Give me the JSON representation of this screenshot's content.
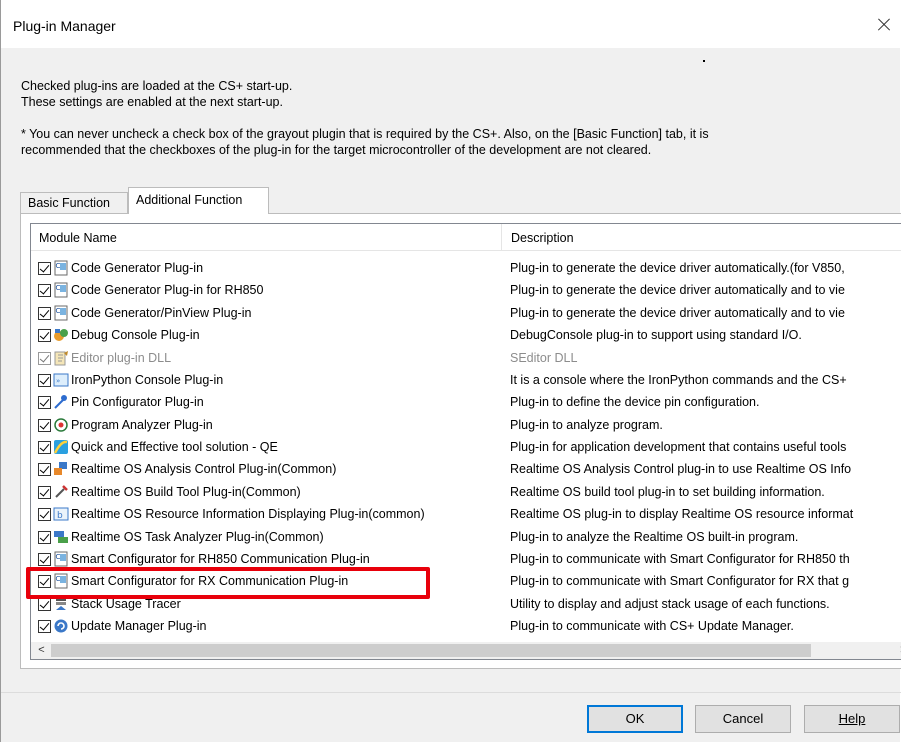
{
  "window": {
    "title": "Plug-in Manager"
  },
  "info": {
    "line1": "Checked plug-ins are loaded at the CS+ start-up.",
    "line2": "These settings are enabled at the next start-up.",
    "note1": "* You can never uncheck a check box of the grayout plugin that is required by the CS+. Also, on the [Basic Function] tab, it is",
    "note2": "recommended that the checkboxes of the plug-in for the target microcontroller of the development are not cleared."
  },
  "tabs": [
    "Basic Function",
    "Additional Function"
  ],
  "active_tab": "Additional Function",
  "columns": {
    "name": "Module Name",
    "description": "Description"
  },
  "rows": [
    {
      "name": "Code Generator Plug-in",
      "description": "Plug-in to generate the device driver automatically.(for V850,",
      "checked": true,
      "gray": false,
      "icon": "c-file-icon"
    },
    {
      "name": "Code Generator Plug-in for RH850",
      "description": "Plug-in to generate the device driver automatically and to vie",
      "checked": true,
      "gray": false,
      "icon": "c-file-icon"
    },
    {
      "name": "Code Generator/PinView Plug-in",
      "description": "Plug-in to generate the device driver automatically and to vie",
      "checked": true,
      "gray": false,
      "icon": "c-file-icon"
    },
    {
      "name": "Debug Console Plug-in",
      "description": "DebugConsole plug-in to support using standard I/O.",
      "checked": true,
      "gray": false,
      "icon": "debug-console-icon"
    },
    {
      "name": "Editor plug-in DLL",
      "description": "SEditor DLL",
      "checked": true,
      "gray": true,
      "icon": "editor-icon"
    },
    {
      "name": "IronPython Console Plug-in",
      "description": "It is a console where the IronPython commands and the CS+",
      "checked": true,
      "gray": false,
      "icon": "console-icon"
    },
    {
      "name": "Pin Configurator Plug-in",
      "description": "Plug-in to define the device pin configuration.",
      "checked": true,
      "gray": false,
      "icon": "pin-icon"
    },
    {
      "name": "Program Analyzer Plug-in",
      "description": "Plug-in to analyze program.",
      "checked": true,
      "gray": false,
      "icon": "analyzer-icon"
    },
    {
      "name": "Quick and Effective tool solution - QE",
      "description": "Plug-in for application development that contains useful tools",
      "checked": true,
      "gray": false,
      "icon": "qe-icon"
    },
    {
      "name": "Realtime OS Analysis Control Plug-in(Common)",
      "description": "Realtime OS Analysis Control plug-in to use Realtime OS Info",
      "checked": true,
      "gray": false,
      "icon": "rtos-analysis-icon"
    },
    {
      "name": "Realtime OS Build Tool Plug-in(Common)",
      "description": "Realtime OS build tool plug-in to set building information.",
      "checked": true,
      "gray": false,
      "icon": "build-tool-icon"
    },
    {
      "name": "Realtime OS Resource Information Displaying Plug-in(common)",
      "description": "Realtime OS plug-in to display Realtime OS resource informat",
      "checked": true,
      "gray": false,
      "icon": "resource-icon"
    },
    {
      "name": "Realtime OS Task Analyzer Plug-in(Common)",
      "description": "Plug-in to analyze the Realtime OS built-in program.",
      "checked": true,
      "gray": false,
      "icon": "task-analyzer-icon"
    },
    {
      "name": "Smart Configurator for RH850 Communication Plug-in",
      "description": "Plug-in to communicate with Smart Configurator for RH850 th",
      "checked": true,
      "gray": false,
      "icon": "c-file-icon"
    },
    {
      "name": "Smart Configurator for RX Communication Plug-in",
      "description": "Plug-in to communicate with Smart Configurator for RX that g",
      "checked": true,
      "gray": false,
      "icon": "c-file-icon"
    },
    {
      "name": "Stack Usage Tracer",
      "description": "Utility to display and adjust stack usage of each functions.",
      "checked": true,
      "gray": false,
      "icon": "stack-icon"
    },
    {
      "name": "Update Manager Plug-in",
      "description": "Plug-in to communicate with CS+ Update Manager.",
      "checked": true,
      "gray": false,
      "icon": "update-icon"
    }
  ],
  "scrollbar": {
    "left": "<",
    "right": ">"
  },
  "buttons": {
    "ok": "OK",
    "cancel": "Cancel",
    "help": "Help"
  },
  "colors": {
    "highlight": "#e8000b",
    "accent": "#0078d7"
  }
}
